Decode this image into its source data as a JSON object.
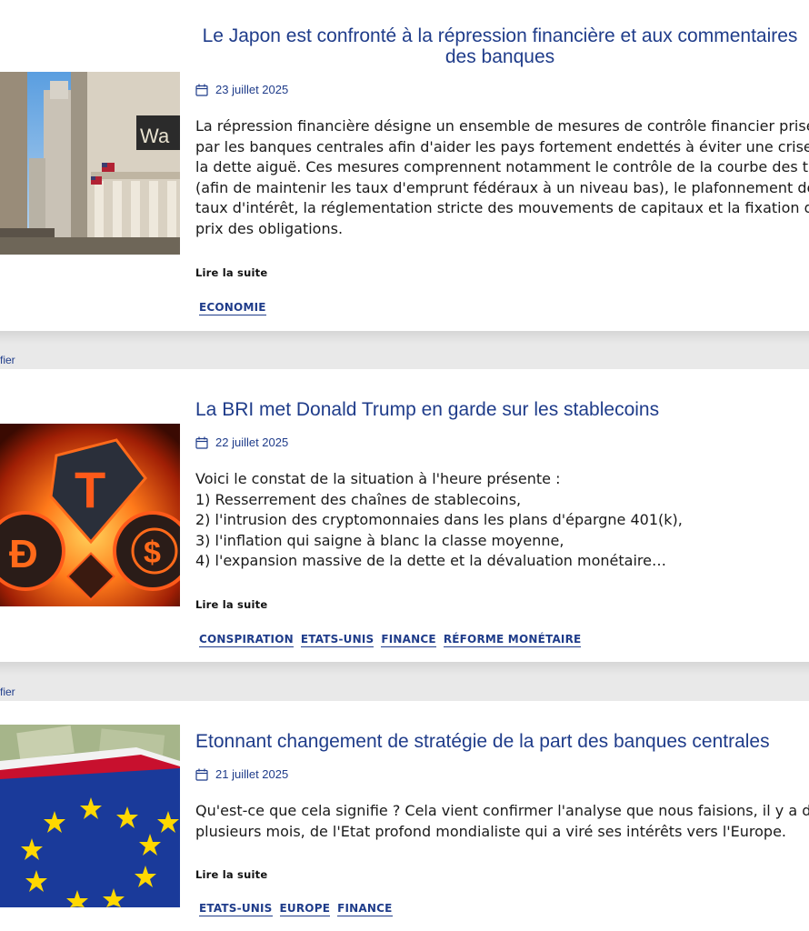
{
  "articles": [
    {
      "title": "Le Japon est confronté à la répression financière et aux commentaires des banques",
      "date": "23 juillet 2025",
      "image_name": "wall-street-image",
      "excerpt_lines": [
        "La répression financière désigne un ensemble de mesures de contrôle financier prises",
        "par les banques centrales afin d'aider les pays fortement endettés à éviter une crise de",
        "la dette aiguë. Ces mesures comprennent notamment le contrôle de la courbe des taux",
        "(afin de maintenir les taux d'emprunt fédéraux à un niveau bas), le plafonnement des",
        "taux d'intérêt, la réglementation stricte des mouvements de capitaux et la fixation des",
        "prix des obligations."
      ],
      "read_more": "Lire la suite",
      "tags": [
        "ECONOMIE"
      ]
    },
    {
      "title": "La BRI met Donald Trump en garde sur les stablecoins",
      "date": "22 juillet 2025",
      "image_name": "stablecoins-fire-image",
      "excerpt_lines": [
        "Voici le constat de la situation à l'heure présente :",
        "1) Resserrement des chaînes de stablecoins,",
        "2) l'intrusion des cryptomonnaies dans les plans d'épargne 401(k),",
        "3) l'inflation qui saigne à blanc la classe moyenne,",
        "4) l'expansion massive de la dette et la dévaluation monétaire…"
      ],
      "read_more": "Lire la suite",
      "tags": [
        "CONSPIRATION",
        "ETATS-UNIS",
        "FINANCE",
        "RÉFORME MONÉTAIRE"
      ]
    },
    {
      "title": "Etonnant changement de stratégie de la part des banques centrales",
      "date": "21 juillet 2025",
      "image_name": "eu-us-flags-image",
      "excerpt_lines": [
        "Qu'est-ce que cela signifie ? Cela vient confirmer l'analyse que nous faisions, il y a déjà",
        "plusieurs mois, de l'Etat profond mondialiste qui a viré ses intérêts vers l'Europe."
      ],
      "read_more": "Lire la suite",
      "tags": [
        "ETATS-UNIS",
        "EUROPE",
        "FINANCE"
      ]
    }
  ],
  "separators": [
    "fier",
    "fier"
  ],
  "icons": {
    "date": "calendar-icon"
  },
  "colors": {
    "link": "#1f3c8a",
    "text": "#1a1a1a",
    "separator": "#e9e9e9"
  }
}
